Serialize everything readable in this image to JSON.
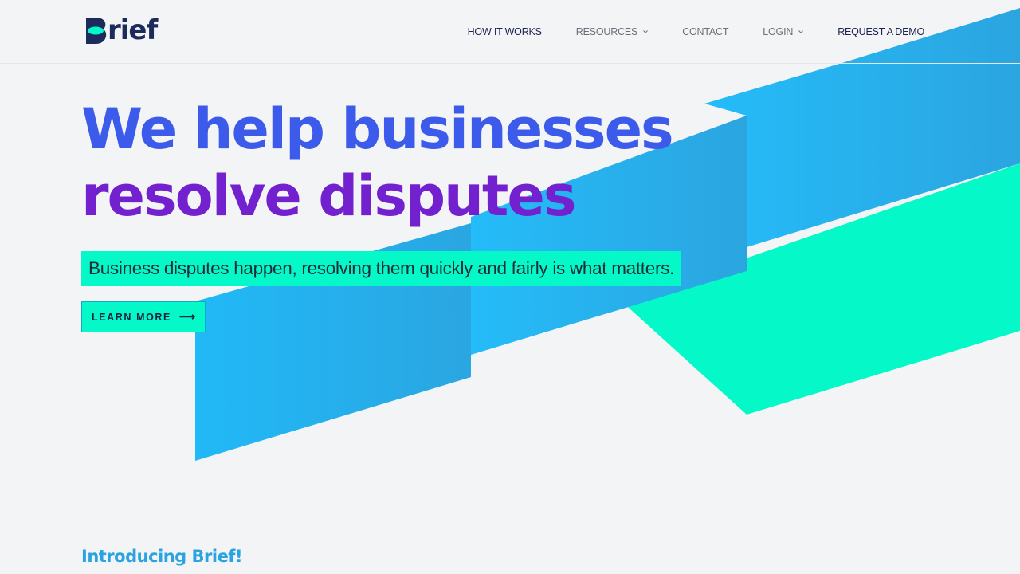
{
  "brand": {
    "logo_text": "rief",
    "accent": "#05f8c7",
    "navy": "#1d2b5c"
  },
  "nav": {
    "items": [
      {
        "label": "HOW IT WORKS",
        "dropdown": false
      },
      {
        "label": "RESOURCES",
        "dropdown": true
      },
      {
        "label": "CONTACT",
        "dropdown": false
      },
      {
        "label": "LOGIN",
        "dropdown": true
      },
      {
        "label": "REQUEST A DEMO",
        "dropdown": false
      }
    ]
  },
  "hero": {
    "headline_line1": "We help businesses",
    "headline_line2": "resolve disputes",
    "subtitle": "Business disputes happen, resolving them quickly and fairly is what matters.",
    "cta_label": "LEARN MORE",
    "cta_icon": "arrow-right-icon"
  },
  "intro": {
    "title": "Introducing Brief!"
  },
  "colors": {
    "headline_blue": "#3c5bea",
    "headline_purple": "#7320cf",
    "ribbon_blue": "#22b8f6",
    "ribbon_teal": "#05f8c7"
  }
}
